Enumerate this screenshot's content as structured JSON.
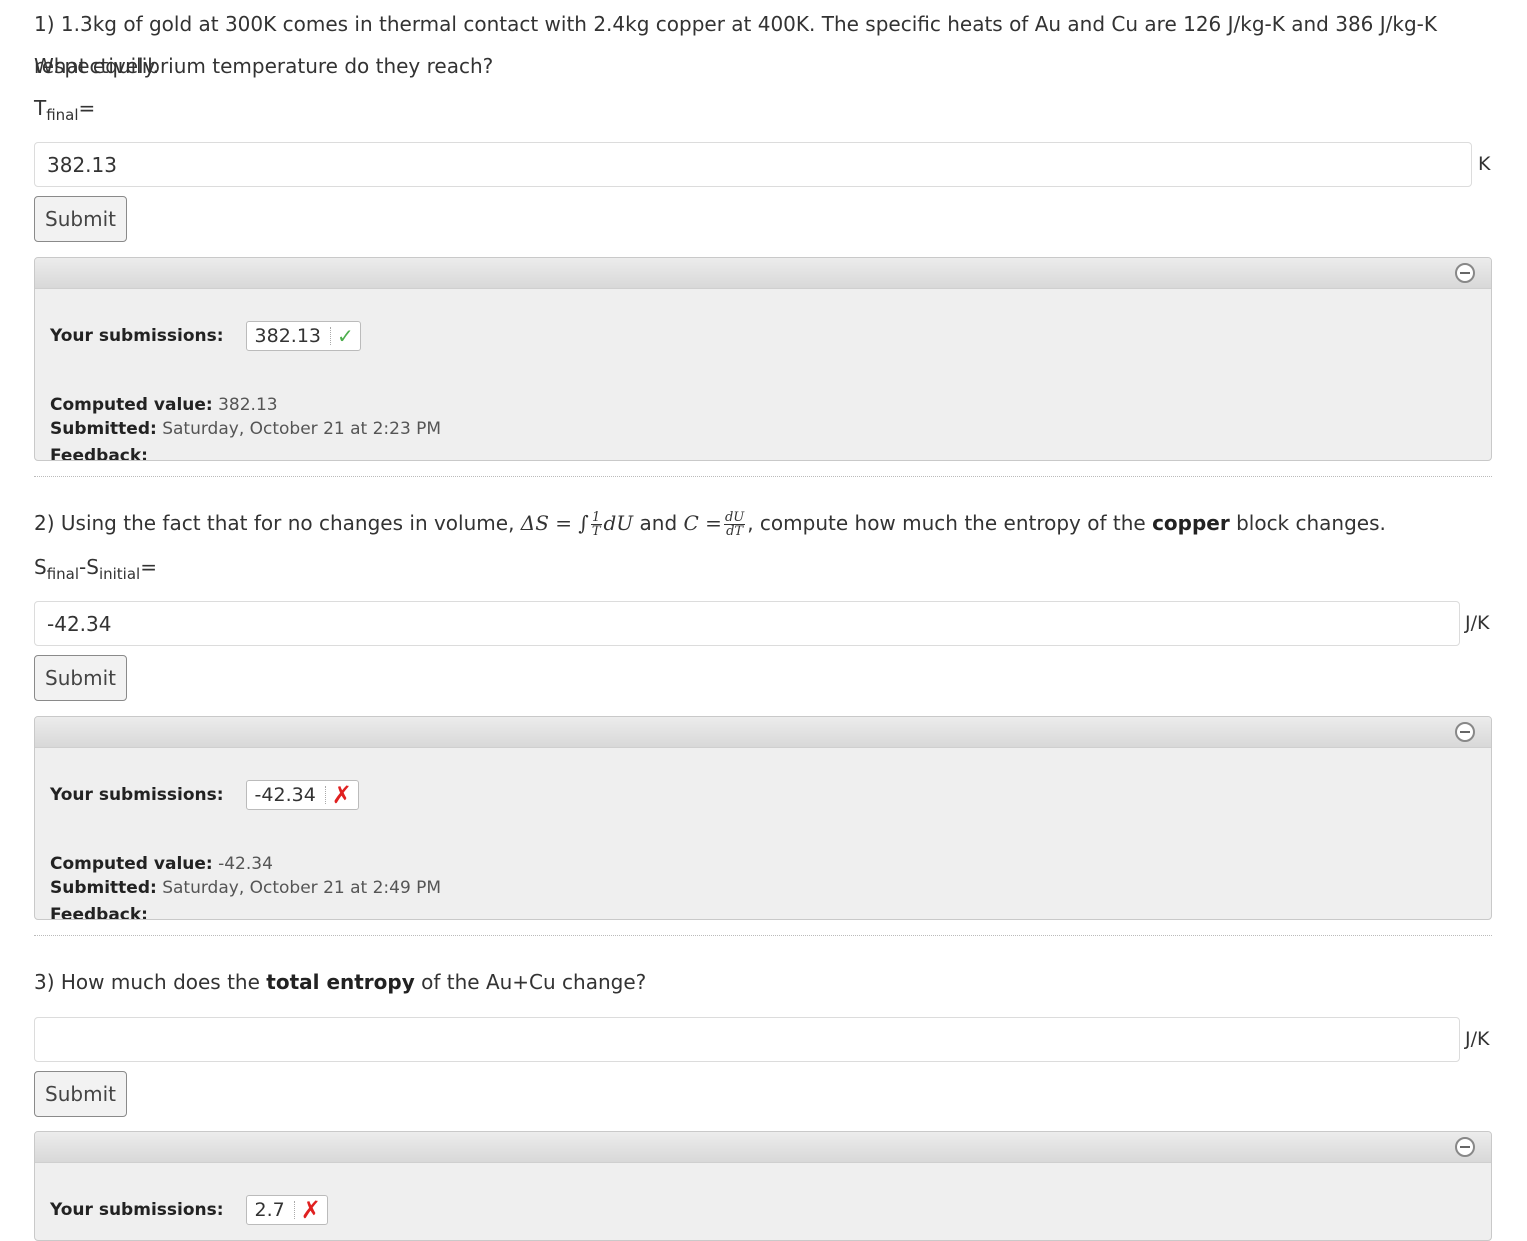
{
  "q1": {
    "line1": "1) 1.3kg of gold at 300K comes in thermal contact with 2.4kg copper at 400K. The specific heats of Au and Cu are 126 J/kg-K and 386 J/kg-K respectively.",
    "line2": "What equilibrium temperature do they reach?",
    "var_main": "T",
    "var_sub": "final",
    "var_eq": "=",
    "answer_value": "382.13",
    "unit": "K",
    "submit_label": "Submit",
    "submissions_label": "Your submissions:",
    "submission_value": "382.13",
    "submission_mark": "✓",
    "computed_label": "Computed value:",
    "computed_value": "382.13",
    "submitted_label": "Submitted:",
    "submitted_value": "Saturday, October 21 at 2:23 PM",
    "feedback_label": "Feedback:"
  },
  "q2": {
    "prefix": "2) Using the fact that for no changes in volume, ",
    "delta_s": "ΔS = ∫",
    "frac1_num": "1",
    "frac1_den": "T",
    "du": "dU",
    "and_text": " and ",
    "c_eq": "C =",
    "frac2_num": "dU",
    "frac2_den": "dT",
    "mid": ", compute how much the entropy of the ",
    "bold_word": "copper",
    "suffix": " block changes.",
    "var_s1": "S",
    "var_sub1": "final",
    "var_dash": "-",
    "var_s2": "S",
    "var_sub2": "initial",
    "var_eq": "=",
    "answer_value": "-42.34",
    "unit": "J/K",
    "submit_label": "Submit",
    "submissions_label": "Your submissions:",
    "submission_value": "-42.34",
    "submission_mark": "✗",
    "computed_label": "Computed value:",
    "computed_value": "-42.34",
    "submitted_label": "Submitted:",
    "submitted_value": "Saturday, October 21 at 2:49 PM",
    "feedback_label": "Feedback:"
  },
  "q3": {
    "prefix": "3) How much does the ",
    "bold_word": "total entropy",
    "suffix": " of the Au+Cu change?",
    "answer_value": "",
    "unit": "J/K",
    "submit_label": "Submit",
    "submissions_label": "Your submissions:",
    "submission_value": "2.7",
    "submission_mark": "✗"
  },
  "colors": {
    "correct": "#4cae4c",
    "incorrect": "#e02020",
    "panel_bg": "#efefef"
  },
  "icons": {
    "collapse": "minus-circle-icon",
    "correct": "check-icon",
    "incorrect": "x-icon"
  }
}
